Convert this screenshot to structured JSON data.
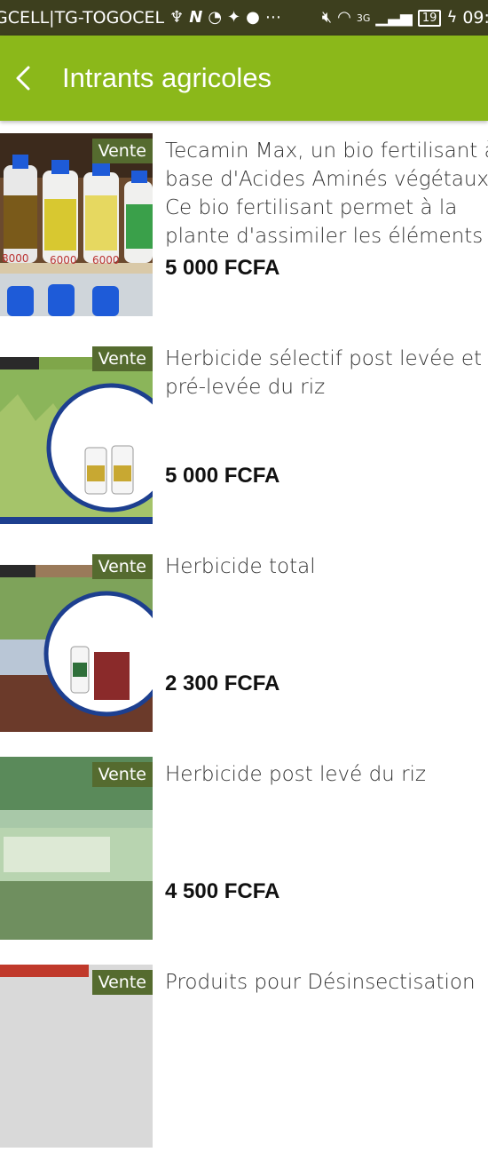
{
  "status_bar": {
    "carrier": "GCELL|TG-TOGOCEL",
    "network": "3G",
    "battery": "19",
    "time": "09:0"
  },
  "appbar": {
    "title": "Intrants agricoles",
    "back_icon": "chevron-left-icon"
  },
  "colors": {
    "appbar": "#8bb81a",
    "statusbar": "#3d3f1e",
    "badge": "#556b2f"
  },
  "products": [
    {
      "badge": "Vente",
      "desc_lines": [
        "Tecamin Max, un bio fertilisant à",
        "base d'Acides Aminés végétaux.",
        "Ce bio fertilisant permet à la",
        "plante d'assimiler les éléments"
      ],
      "price": "5 000 FCFA"
    },
    {
      "badge": "Vente",
      "desc_lines": [
        "Herbicide sélectif post levée et",
        "pré-levée du riz"
      ],
      "price": "5 000 FCFA"
    },
    {
      "badge": "Vente",
      "desc_lines": [
        "Herbicide total"
      ],
      "price": "2 300 FCFA"
    },
    {
      "badge": "Vente",
      "desc_lines": [
        "Herbicide post levé du riz"
      ],
      "price": "4 500 FCFA"
    },
    {
      "badge": "Vente",
      "desc_lines": [
        "Produits pour Désinsectisation"
      ],
      "price": ""
    }
  ]
}
